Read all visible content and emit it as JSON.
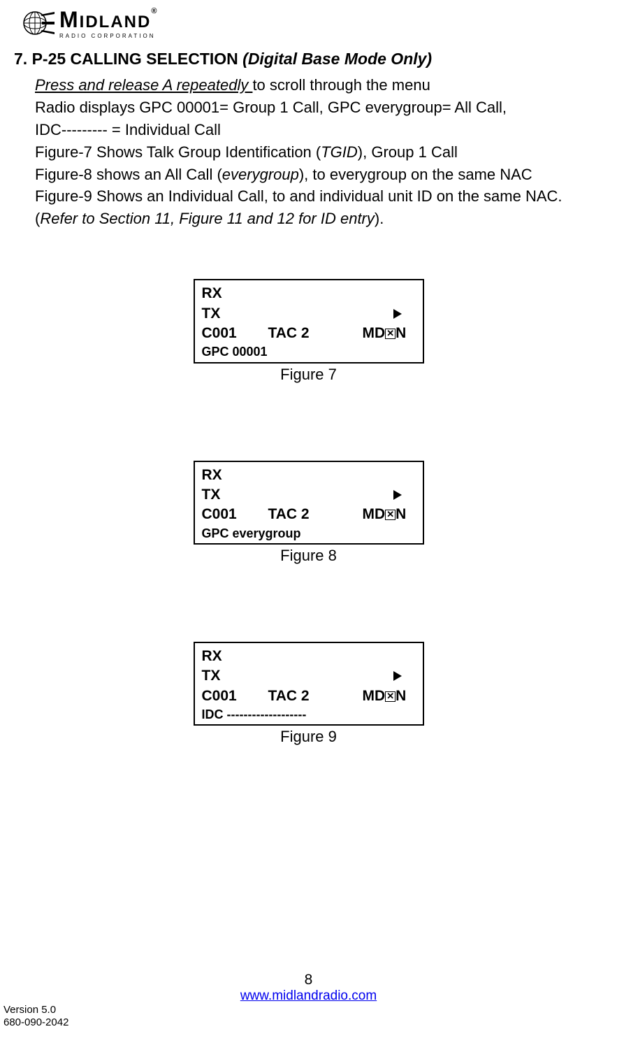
{
  "logo": {
    "brand_m": "M",
    "brand_rest": "IDLAND",
    "sub": "RADIO CORPORATION",
    "reg": "®"
  },
  "section": {
    "number_title": "7. P-25 CALLING SELECTION ",
    "italic_part": "(Digital Base Mode Only)"
  },
  "body": {
    "line1_underline": "Press and release A repeatedly ",
    "line1_rest": "to scroll through the menu",
    "line2": "Radio displays GPC 00001= Group 1 Call, GPC everygroup= All Call,",
    "line3": "IDC--------- = Individual Call",
    "line4a": "Figure-7 Shows Talk Group Identification (",
    "line4b": "TGID",
    "line4c": "), Group 1 Call",
    "line5a": "Figure-8 shows an All Call (",
    "line5b": "everygroup",
    "line5c": "), to everygroup on the same NAC",
    "line6": "Figure-9 Shows an Individual Call, to and individual unit ID on the same NAC.",
    "line7a": "(",
    "line7b": "Refer to Section 11, Figure 11 and 12 for ID entry",
    "line7c": ")."
  },
  "figures": {
    "common": {
      "rx": "RX",
      "tx": "TX",
      "c001": "C001",
      "tac2": "TAC 2",
      "md_pre": "MD",
      "xbox": "✕",
      "md_post": "N"
    },
    "fig7": {
      "lastline": "GPC 00001",
      "caption": "Figure 7"
    },
    "fig8": {
      "lastline": "GPC everygroup",
      "caption": "Figure 8"
    },
    "fig9": {
      "lastline": "IDC  -------------------",
      "caption": "Figure 9"
    }
  },
  "footer": {
    "page": "8",
    "url": "www.midlandradio.com",
    "version": "Version 5.0",
    "partnum": "680-090-2042"
  }
}
